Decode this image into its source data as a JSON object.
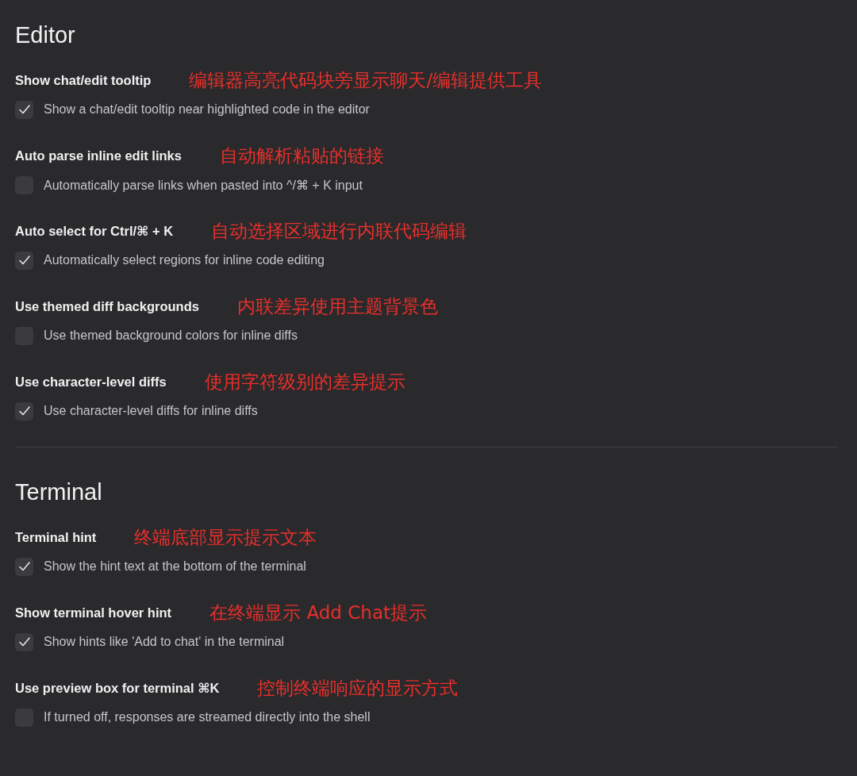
{
  "sections": [
    {
      "title": "Editor",
      "settings": [
        {
          "label": "Show chat/edit tooltip",
          "annotation": "编辑器高亮代码块旁显示聊天/编辑提供工具",
          "description": "Show a chat/edit tooltip near highlighted code in the editor",
          "checked": true
        },
        {
          "label": "Auto parse inline edit links",
          "annotation": "自动解析粘贴的链接",
          "description": "Automatically parse links when pasted into ^/⌘ + K input",
          "checked": false
        },
        {
          "label": "Auto select for Ctrl/⌘ + K",
          "annotation": "自动选择区域进行内联代码编辑",
          "description": "Automatically select regions for inline code editing",
          "checked": true
        },
        {
          "label": "Use themed diff backgrounds",
          "annotation": "内联差异使用主题背景色",
          "description": "Use themed background colors for inline diffs",
          "checked": false
        },
        {
          "label": "Use character-level diffs",
          "annotation": "使用字符级别的差异提示",
          "description": "Use character-level diffs for inline diffs",
          "checked": true
        }
      ]
    },
    {
      "title": "Terminal",
      "settings": [
        {
          "label": "Terminal hint",
          "annotation": "终端底部显示提示文本",
          "description": "Show the hint text at the bottom of the terminal",
          "checked": true
        },
        {
          "label": "Show terminal hover hint",
          "annotation": "在终端显示 Add Chat提示",
          "description": "Show hints like 'Add to chat' in the terminal",
          "checked": true
        },
        {
          "label": "Use preview box for terminal ⌘K",
          "annotation": "控制终端响应的显示方式",
          "description": "If turned off, responses are streamed directly into the shell",
          "checked": false
        }
      ]
    }
  ]
}
